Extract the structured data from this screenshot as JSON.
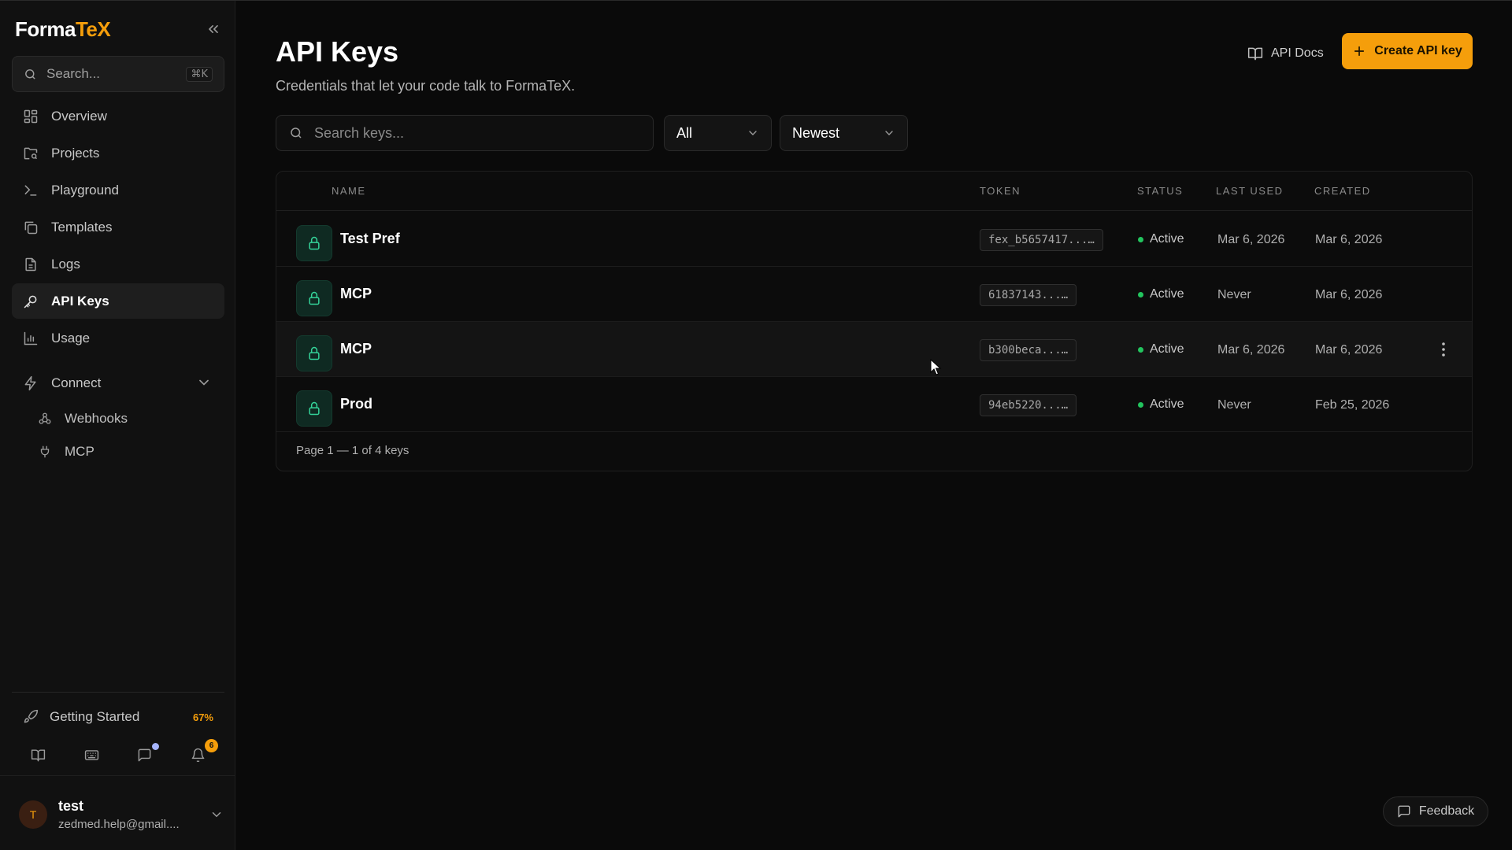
{
  "app": {
    "logo_main": "Forma",
    "logo_accent": "TeX"
  },
  "sidebar": {
    "search_placeholder": "Search...",
    "search_shortcut": "⌘K",
    "items": [
      {
        "label": "Overview",
        "icon": "grid-icon"
      },
      {
        "label": "Projects",
        "icon": "folder-search-icon"
      },
      {
        "label": "Playground",
        "icon": "terminal-icon"
      },
      {
        "label": "Templates",
        "icon": "copy-icon"
      },
      {
        "label": "Logs",
        "icon": "file-text-icon"
      },
      {
        "label": "API Keys",
        "icon": "key-icon",
        "active": true
      },
      {
        "label": "Usage",
        "icon": "bar-chart-icon"
      }
    ],
    "connect": {
      "label": "Connect",
      "icon": "zap-icon",
      "children": [
        {
          "label": "Webhooks",
          "icon": "webhook-icon"
        },
        {
          "label": "MCP",
          "icon": "plug-icon"
        }
      ]
    },
    "getting_started": {
      "label": "Getting Started",
      "progress": "67%"
    },
    "notification_count": "6",
    "user": {
      "initial": "T",
      "name": "test",
      "email": "zedmed.help@gmail...."
    }
  },
  "header": {
    "title": "API Keys",
    "subtitle": "Credentials that let your code talk to FormaTeX.",
    "docs_label": "API Docs",
    "create_label": "Create API key"
  },
  "filters": {
    "search_placeholder": "Search keys...",
    "status_value": "All",
    "sort_value": "Newest"
  },
  "table": {
    "columns": {
      "name": "NAME",
      "token": "TOKEN",
      "status": "STATUS",
      "last_used": "LAST USED",
      "created": "CREATED"
    },
    "rows": [
      {
        "name": "Test Pref",
        "token": "fex_b5657417...…",
        "status": "Active",
        "last_used": "Mar 6, 2026",
        "created": "Mar 6, 2026"
      },
      {
        "name": "MCP",
        "token": "61837143...…",
        "status": "Active",
        "last_used": "Never",
        "created": "Mar 6, 2026"
      },
      {
        "name": "MCP",
        "token": "b300beca...…",
        "status": "Active",
        "last_used": "Mar 6, 2026",
        "created": "Mar 6, 2026"
      },
      {
        "name": "Prod",
        "token": "94eb5220...…",
        "status": "Active",
        "last_used": "Never",
        "created": "Feb 25, 2026"
      }
    ],
    "pagination": "Page 1 — 1 of 4 keys"
  },
  "feedback_label": "Feedback",
  "colors": {
    "accent": "#f59e0b",
    "status_active": "#22c55e",
    "key_icon": "#34d399"
  }
}
